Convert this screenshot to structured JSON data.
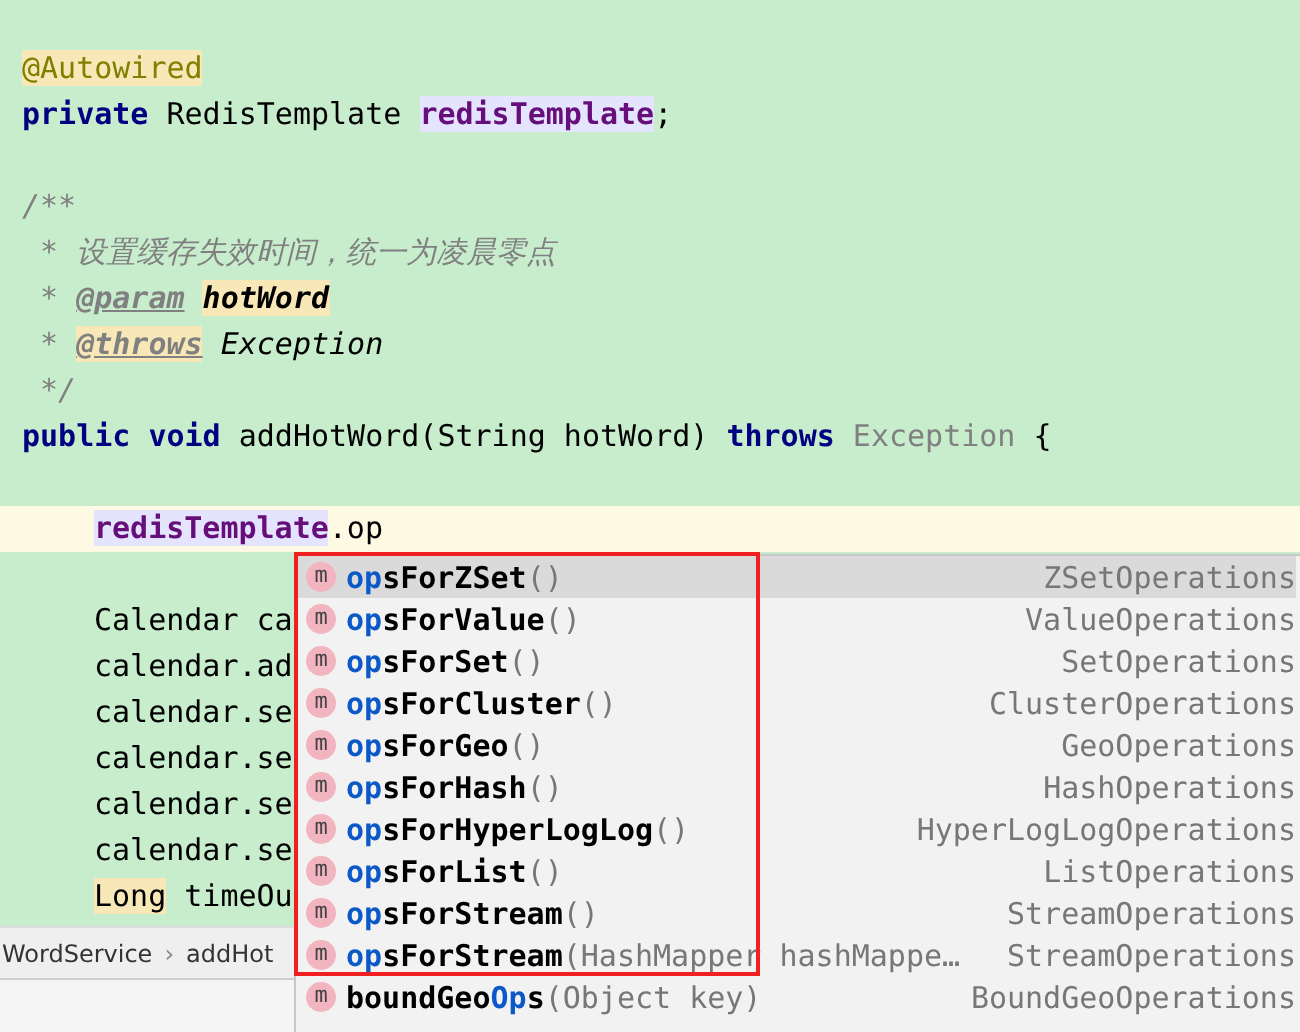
{
  "editor": {
    "lines": [
      {
        "kind": "member",
        "current": false
      },
      {
        "kind": "member",
        "current": false,
        "tokens": [
          {
            "text": "@Autowired",
            "kind": "annotation"
          }
        ]
      },
      {
        "kind": "member",
        "current": false,
        "tokens": [
          {
            "text": "private",
            "kind": "keyword"
          },
          {
            "text": " RedisTemplate ",
            "kind": "plain"
          },
          {
            "text": "redisTemplate",
            "kind": "field_marked"
          },
          {
            "text": ";",
            "kind": "plain"
          }
        ]
      },
      {
        "kind": "member",
        "current": false
      },
      {
        "kind": "member",
        "current": false,
        "tokens": [
          {
            "text": "/**",
            "kind": "comment"
          }
        ]
      },
      {
        "kind": "member",
        "current": false,
        "tokens": [
          {
            "text": " * 设置缓存失效时间，统一为凌晨零点",
            "kind": "comment"
          }
        ]
      },
      {
        "kind": "member",
        "current": false,
        "tokens": [
          {
            "text": " * ",
            "kind": "comment"
          },
          {
            "text": "@param",
            "kind": "doc_tag"
          },
          {
            "text": "hotWord",
            "kind": "doc_param"
          }
        ]
      },
      {
        "kind": "member",
        "current": false,
        "tokens": [
          {
            "text": " * ",
            "kind": "comment"
          },
          {
            "text": "@throws",
            "kind": "doc_tag_marked"
          },
          {
            "text": " Exception",
            "kind": "doc_ref"
          }
        ]
      },
      {
        "kind": "member",
        "current": false,
        "tokens": [
          {
            "text": " */",
            "kind": "comment"
          }
        ]
      },
      {
        "kind": "member",
        "current": false,
        "tokens": [
          {
            "text": "public",
            "kind": "keyword"
          },
          {
            "text": " void",
            "kind": "keyword"
          },
          {
            "text": " addHotWord(String hotWord) ",
            "kind": "plain"
          },
          {
            "text": "throws",
            "kind": "keyword"
          },
          {
            "text": " Exception",
            "kind": "unused"
          },
          {
            "text": " {",
            "kind": "plain"
          }
        ]
      },
      {
        "kind": "member",
        "current": false
      },
      {
        "kind": "body",
        "current": true,
        "tokens": [
          {
            "text": "redisTemplate",
            "kind": "field_marked"
          },
          {
            "text": ".op",
            "kind": "plain"
          }
        ]
      },
      {
        "kind": "body",
        "current": false
      },
      {
        "kind": "body",
        "current": false,
        "tokens": [
          {
            "text": "Calendar ca",
            "kind": "plain"
          }
        ]
      },
      {
        "kind": "body",
        "current": false,
        "tokens": [
          {
            "text": "calendar.ad",
            "kind": "plain"
          }
        ]
      },
      {
        "kind": "body",
        "current": false,
        "tokens": [
          {
            "text": "calendar.se",
            "kind": "plain"
          }
        ]
      },
      {
        "kind": "body",
        "current": false,
        "tokens": [
          {
            "text": "calendar.se",
            "kind": "plain"
          }
        ]
      },
      {
        "kind": "body",
        "current": false,
        "tokens": [
          {
            "text": "calendar.se",
            "kind": "plain"
          }
        ]
      },
      {
        "kind": "body",
        "current": false,
        "tokens": [
          {
            "text": "calendar.se",
            "kind": "plain"
          }
        ]
      },
      {
        "kind": "body",
        "current": false,
        "tokens": [
          {
            "text": "Long",
            "kind": "plain_marked"
          },
          {
            "text": " timeOu",
            "kind": "plain"
          }
        ]
      }
    ]
  },
  "breadcrumbs": [
    {
      "label": "WordService"
    },
    {
      "label": "addHot"
    }
  ],
  "breadcrumb_separator": "›",
  "completion": {
    "items": [
      {
        "icon": "m",
        "name": [
          {
            "text": "op",
            "match": true
          },
          {
            "text": "sForZSet",
            "match": false
          }
        ],
        "params": "()",
        "type": "ZSetOperations",
        "selected": true
      },
      {
        "icon": "m",
        "name": [
          {
            "text": "op",
            "match": true
          },
          {
            "text": "sForValue",
            "match": false
          }
        ],
        "params": "()",
        "type": "ValueOperations",
        "selected": false
      },
      {
        "icon": "m",
        "name": [
          {
            "text": "op",
            "match": true
          },
          {
            "text": "sForSet",
            "match": false
          }
        ],
        "params": "()",
        "type": "SetOperations",
        "selected": false
      },
      {
        "icon": "m",
        "name": [
          {
            "text": "op",
            "match": true
          },
          {
            "text": "sForCluster",
            "match": false
          }
        ],
        "params": "()",
        "type": "ClusterOperations",
        "selected": false
      },
      {
        "icon": "m",
        "name": [
          {
            "text": "op",
            "match": true
          },
          {
            "text": "sForGeo",
            "match": false
          }
        ],
        "params": "()",
        "type": "GeoOperations",
        "selected": false
      },
      {
        "icon": "m",
        "name": [
          {
            "text": "op",
            "match": true
          },
          {
            "text": "sForHash",
            "match": false
          }
        ],
        "params": "()",
        "type": "HashOperations",
        "selected": false
      },
      {
        "icon": "m",
        "name": [
          {
            "text": "op",
            "match": true
          },
          {
            "text": "sForHyperLogLog",
            "match": false
          }
        ],
        "params": "()",
        "type": "HyperLogLogOperations",
        "selected": false
      },
      {
        "icon": "m",
        "name": [
          {
            "text": "op",
            "match": true
          },
          {
            "text": "sForList",
            "match": false
          }
        ],
        "params": "()",
        "type": "ListOperations",
        "selected": false
      },
      {
        "icon": "m",
        "name": [
          {
            "text": "op",
            "match": true
          },
          {
            "text": "sForStream",
            "match": false
          }
        ],
        "params": "()",
        "type": "StreamOperations",
        "selected": false
      },
      {
        "icon": "m",
        "name": [
          {
            "text": "op",
            "match": true
          },
          {
            "text": "sForStream",
            "match": false
          }
        ],
        "params": "(HashMapper hashMappe…",
        "type": "StreamOperations",
        "selected": false
      },
      {
        "icon": "m",
        "name": [
          {
            "text": "boundGeo",
            "match": false
          },
          {
            "text": "Op",
            "match": true
          },
          {
            "text": "s",
            "match": false
          }
        ],
        "params": "(Object key)",
        "type": "BoundGeoOperations",
        "selected": false
      }
    ]
  }
}
